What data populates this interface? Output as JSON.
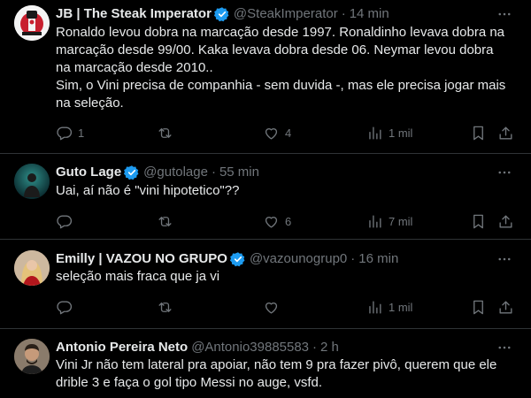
{
  "tweets": [
    {
      "display_name": "JB | The Steak Imperator",
      "handle": "@SteakImperator",
      "time": "14 min",
      "text": "Ronaldo levou dobra na marcação desde 1997. Ronaldinho levava dobra na\nmarcação desde 99/00. Kaka levava dobra desde 06. Neymar levou dobra\nna marcação desde 2010..\nSim, o Vini precisa de companhia - sem duvida -, mas ele precisa jogar mais\nna seleção.",
      "replies": "1",
      "retweets": "",
      "likes": "4",
      "views": "1 mil"
    },
    {
      "display_name": "Guto Lage",
      "handle": "@gutolage",
      "time": "55 min",
      "text": "Uai, aí não é \"vini hipotetico\"??",
      "replies": "",
      "retweets": "",
      "likes": "6",
      "views": "7 mil"
    },
    {
      "display_name": "Emilly | VAZOU NO GRUPO",
      "handle": "@vazounogrup0",
      "time": "16 min",
      "text": "seleção mais fraca que ja vi",
      "replies": "",
      "retweets": "",
      "likes": "",
      "views": "1 mil"
    },
    {
      "display_name": "Antonio Pereira Neto",
      "handle": "@Antonio39885583",
      "time": "2 h",
      "text": "Vini Jr não tem lateral pra apoiar, não tem 9 pra fazer pivô, querem que ele\ndrible 3 e faça o gol tipo Messi no auge, vsfd.",
      "replies": "",
      "retweets": "",
      "likes": "",
      "views": ""
    }
  ],
  "separator": "·",
  "colors": {
    "background": "#000000",
    "text": "#e7e9ea",
    "secondary": "#71767b",
    "divider": "#2f3336",
    "verified": "#1d9bf0"
  },
  "icons": [
    "more-icon",
    "verified-badge-icon",
    "reply-icon",
    "retweet-icon",
    "like-icon",
    "views-icon",
    "bookmark-icon",
    "share-icon"
  ]
}
